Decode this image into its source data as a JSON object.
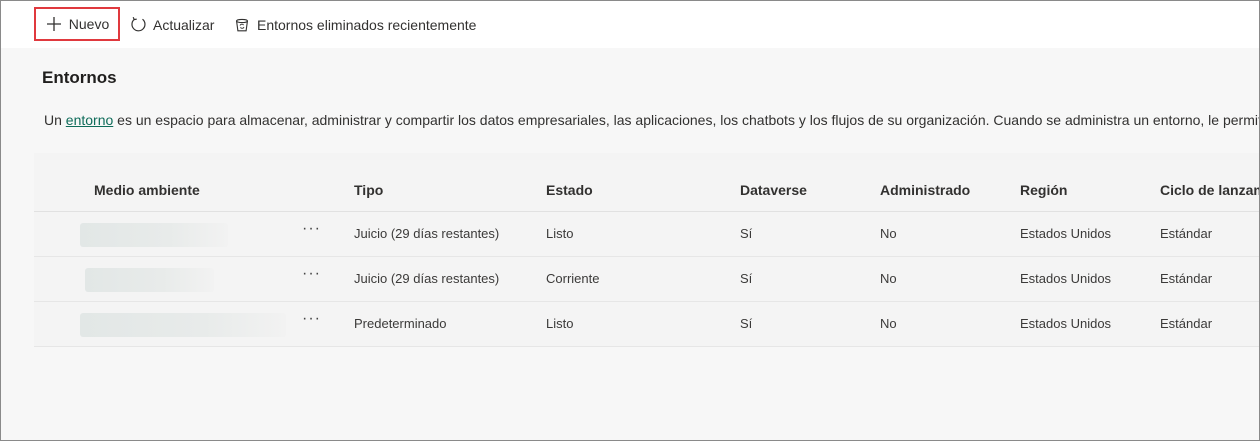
{
  "commands": {
    "new_label": "Nuevo",
    "refresh_label": "Actualizar",
    "deleted_label": "Entornos eliminados recientemente"
  },
  "page": {
    "title": "Entornos",
    "desc_prefix": "Un ",
    "desc_link": "entorno",
    "desc_suffix": " es un espacio para almacenar, administrar y compartir los datos empresariales, las aplicaciones, los chatbots y los flujos de su organización. Cuando se administra un entorno, le permite"
  },
  "table": {
    "headers": [
      "Medio ambiente",
      "Tipo",
      "Estado",
      "Dataverse",
      "Administrado",
      "Región",
      "Ciclo de lanzam"
    ],
    "rows": [
      {
        "more": "···",
        "tipo": "Juicio (29 días restantes)",
        "estado": "Listo",
        "dataverse": "Sí",
        "administrado": "No",
        "region": "Estados Unidos",
        "ciclo": "Estándar"
      },
      {
        "more": "···",
        "tipo": "Juicio (29 días restantes)",
        "estado": "Corriente",
        "dataverse": "Sí",
        "administrado": "No",
        "region": "Estados Unidos",
        "ciclo": "Estándar"
      },
      {
        "more": "···",
        "tipo": "Predeterminado",
        "estado": "Listo",
        "dataverse": "Sí",
        "administrado": "No",
        "region": "Estados Unidos",
        "ciclo": "Estándar"
      }
    ]
  },
  "colors": {
    "highlight_border": "#e0393e",
    "link": "#0f6c5a",
    "background": "#f7f7f7"
  }
}
